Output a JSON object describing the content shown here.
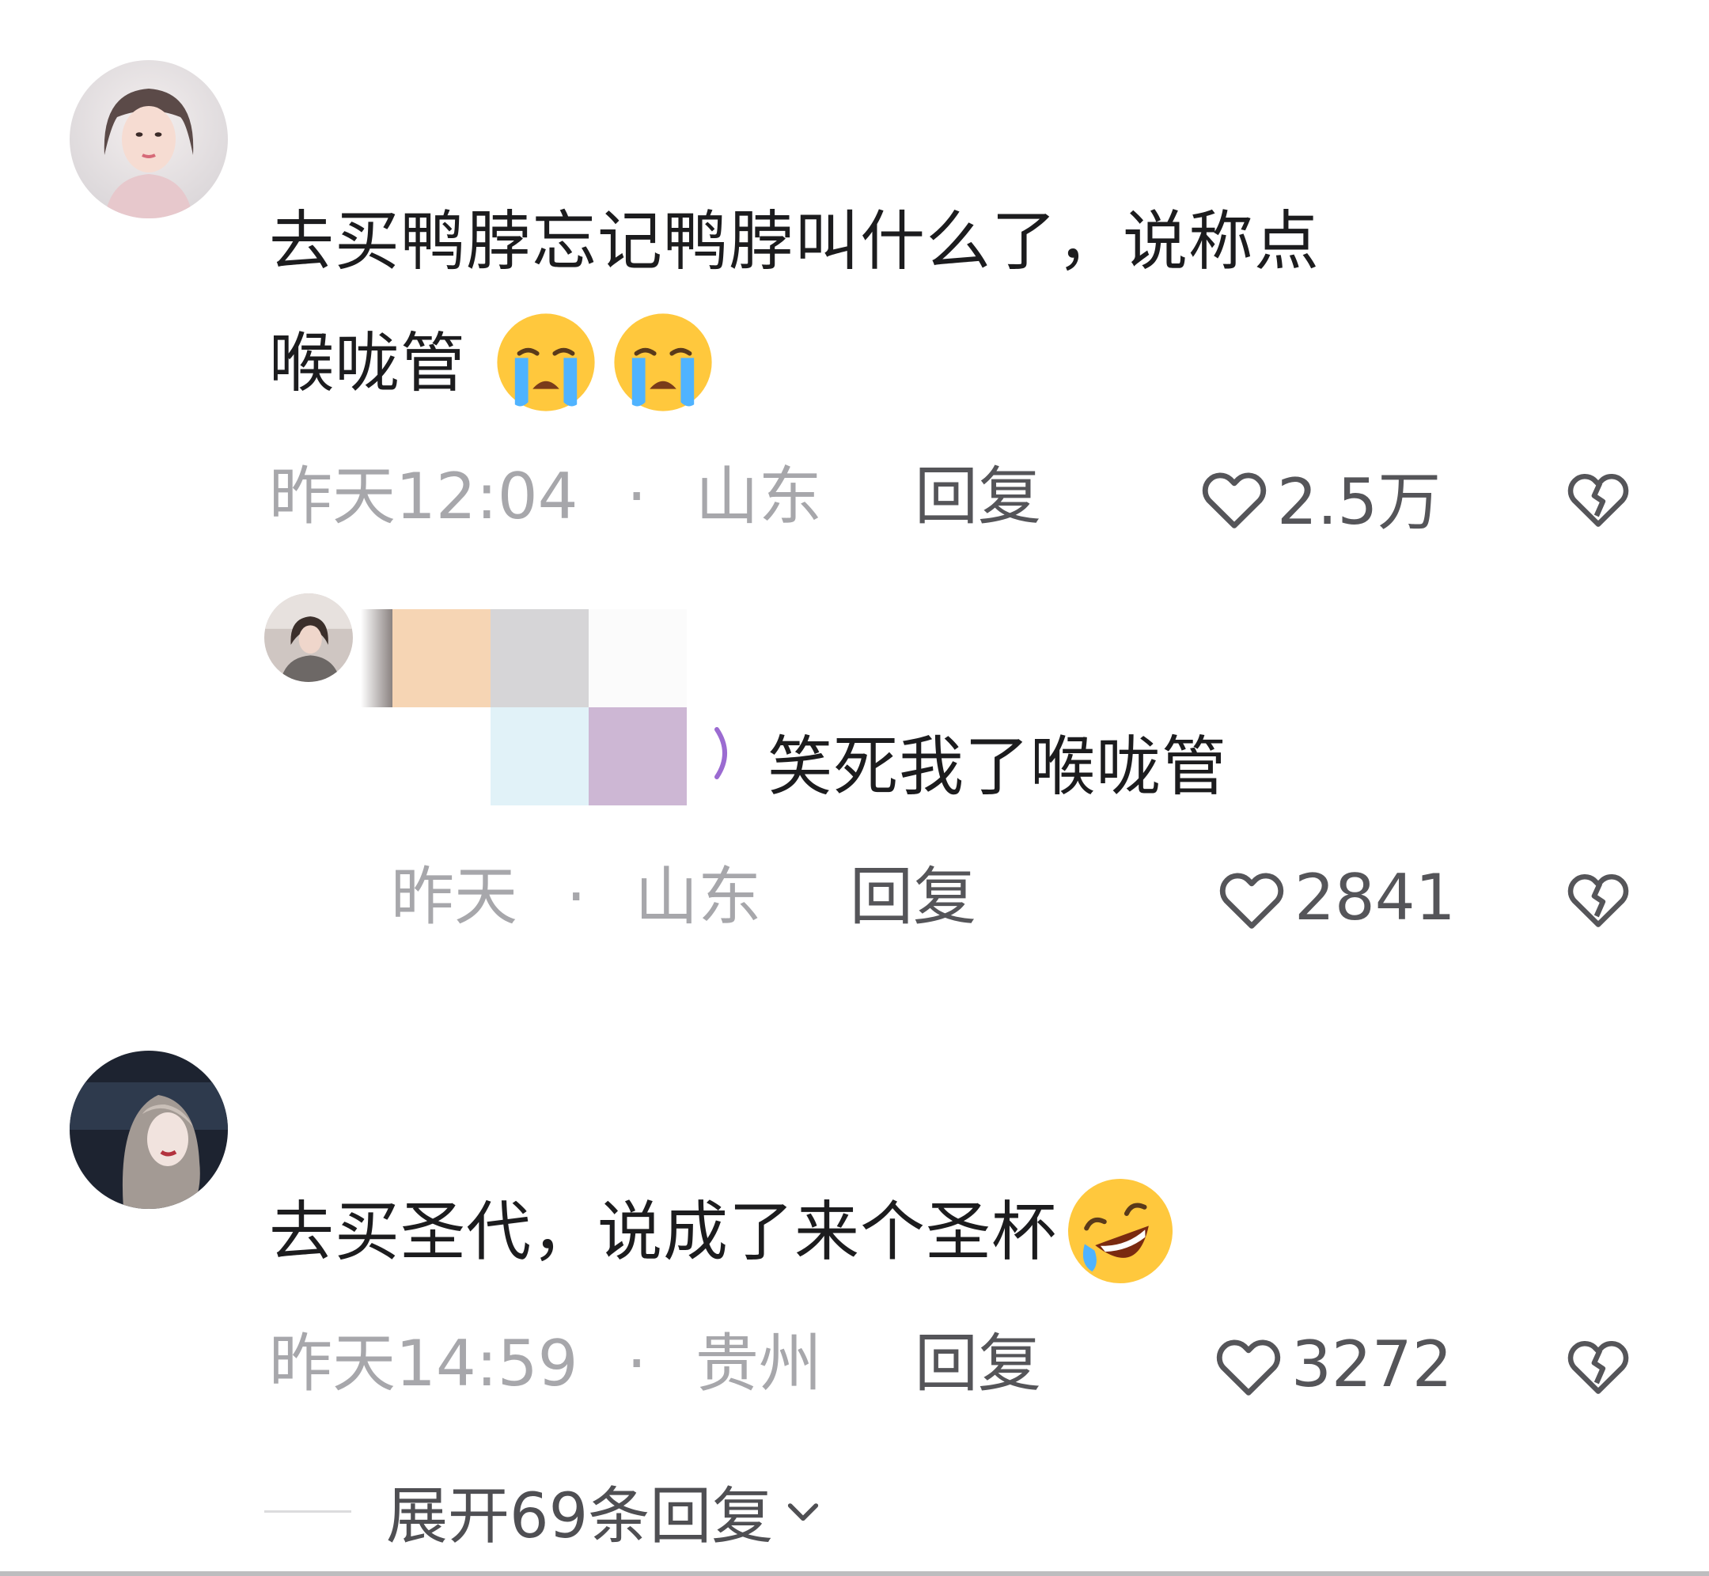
{
  "comments": [
    {
      "text_line1": "去买鸭脖忘记鸭脖叫什么了，说称点",
      "text_line2": "喉咙管",
      "emojis": [
        "loudly-crying-face-emoji",
        "loudly-crying-face-emoji"
      ],
      "time": "昨天12:04",
      "separator": "·",
      "location": "山东",
      "reply_label": "回复",
      "likes": "2.5万"
    },
    {
      "is_reply": true,
      "text": "笑死我了喉咙管",
      "time": "昨天",
      "separator": "·",
      "location": "山东",
      "reply_label": "回复",
      "likes": "2841"
    },
    {
      "text": "去买圣代，说成了来个圣杯",
      "emojis": [
        "rolling-on-floor-laughing-emoji"
      ],
      "time": "昨天14:59",
      "separator": "·",
      "location": "贵州",
      "reply_label": "回复",
      "likes": "3272",
      "expand_label": "展开69条回复"
    }
  ],
  "colors": {
    "text": "#1c1c1e",
    "meta": "#a7a7ab",
    "action": "#555559",
    "divider": "#dcdcde",
    "emoji_face": "#ffc83d",
    "emoji_tear": "#4fb3ff"
  },
  "icons": {
    "like": "heart-outline-icon",
    "dislike": "broken-heart-icon",
    "expand": "chevron-down-icon"
  }
}
